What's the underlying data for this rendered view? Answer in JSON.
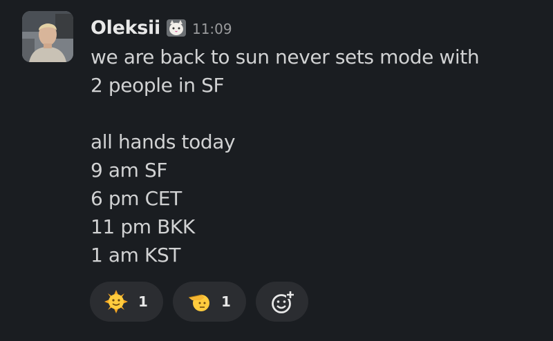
{
  "message": {
    "author": "Oleksii",
    "timestamp": "11:09",
    "status_emoji": "cat-emoji",
    "lines": [
      "we are back to sun never sets mode with",
      "2 people in SF",
      "",
      "all hands today",
      "9 am SF",
      "6 pm CET",
      "11 pm BKK",
      "1 am KST"
    ]
  },
  "reactions": [
    {
      "emoji": "sun-with-face-emoji",
      "count": "1"
    },
    {
      "emoji": "saluting-face-emoji",
      "count": "1"
    }
  ],
  "add_reaction": {
    "icon": "add-reaction-icon"
  },
  "colors": {
    "background": "#1a1d21",
    "text": "#d1d2d3",
    "muted": "#9b9c9e",
    "pill": "#2b2d31"
  }
}
